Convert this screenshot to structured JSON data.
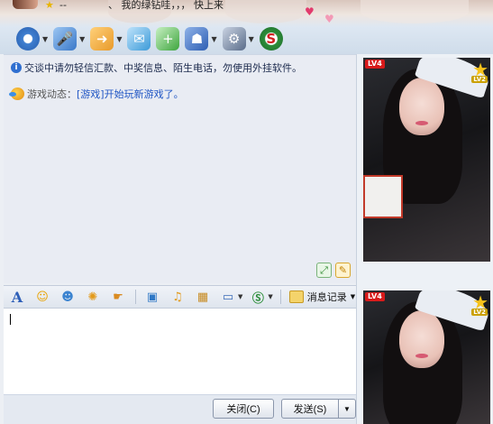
{
  "header": {
    "name_text": "--",
    "signature": "、 我的绿钻哇，，，  快上来"
  },
  "toolbar": {
    "items": [
      {
        "icon": "video-call-icon",
        "color": "#3f7fd0"
      },
      {
        "icon": "voice-call-icon",
        "color": "#4a8ee0"
      },
      {
        "icon": "send-file-icon",
        "color": "#e89a2a"
      },
      {
        "icon": "email-icon",
        "color": "#3b9ad8"
      },
      {
        "icon": "app-add-icon",
        "color": "#3ea53e"
      },
      {
        "icon": "police-icon",
        "color": "#2d5eb3"
      },
      {
        "icon": "settings-icon",
        "color": "#5a6c8a"
      },
      {
        "icon": "s-logo-icon",
        "color": "#2c8d3a"
      }
    ]
  },
  "chat": {
    "notice": "交谈中请勿轻信汇款、中奖信息、陌生电话，勿使用外挂软件。",
    "game_label": "游戏动态：",
    "game_link": "[游戏]",
    "game_text": "开始玩新游戏了。"
  },
  "format_bar": {
    "message_log_label": "消息记录"
  },
  "buttons": {
    "close_label": "关闭(C)",
    "send_label": "发送(S)"
  },
  "profile": {
    "level_badge": "LV4",
    "level_tag": "LV2"
  }
}
